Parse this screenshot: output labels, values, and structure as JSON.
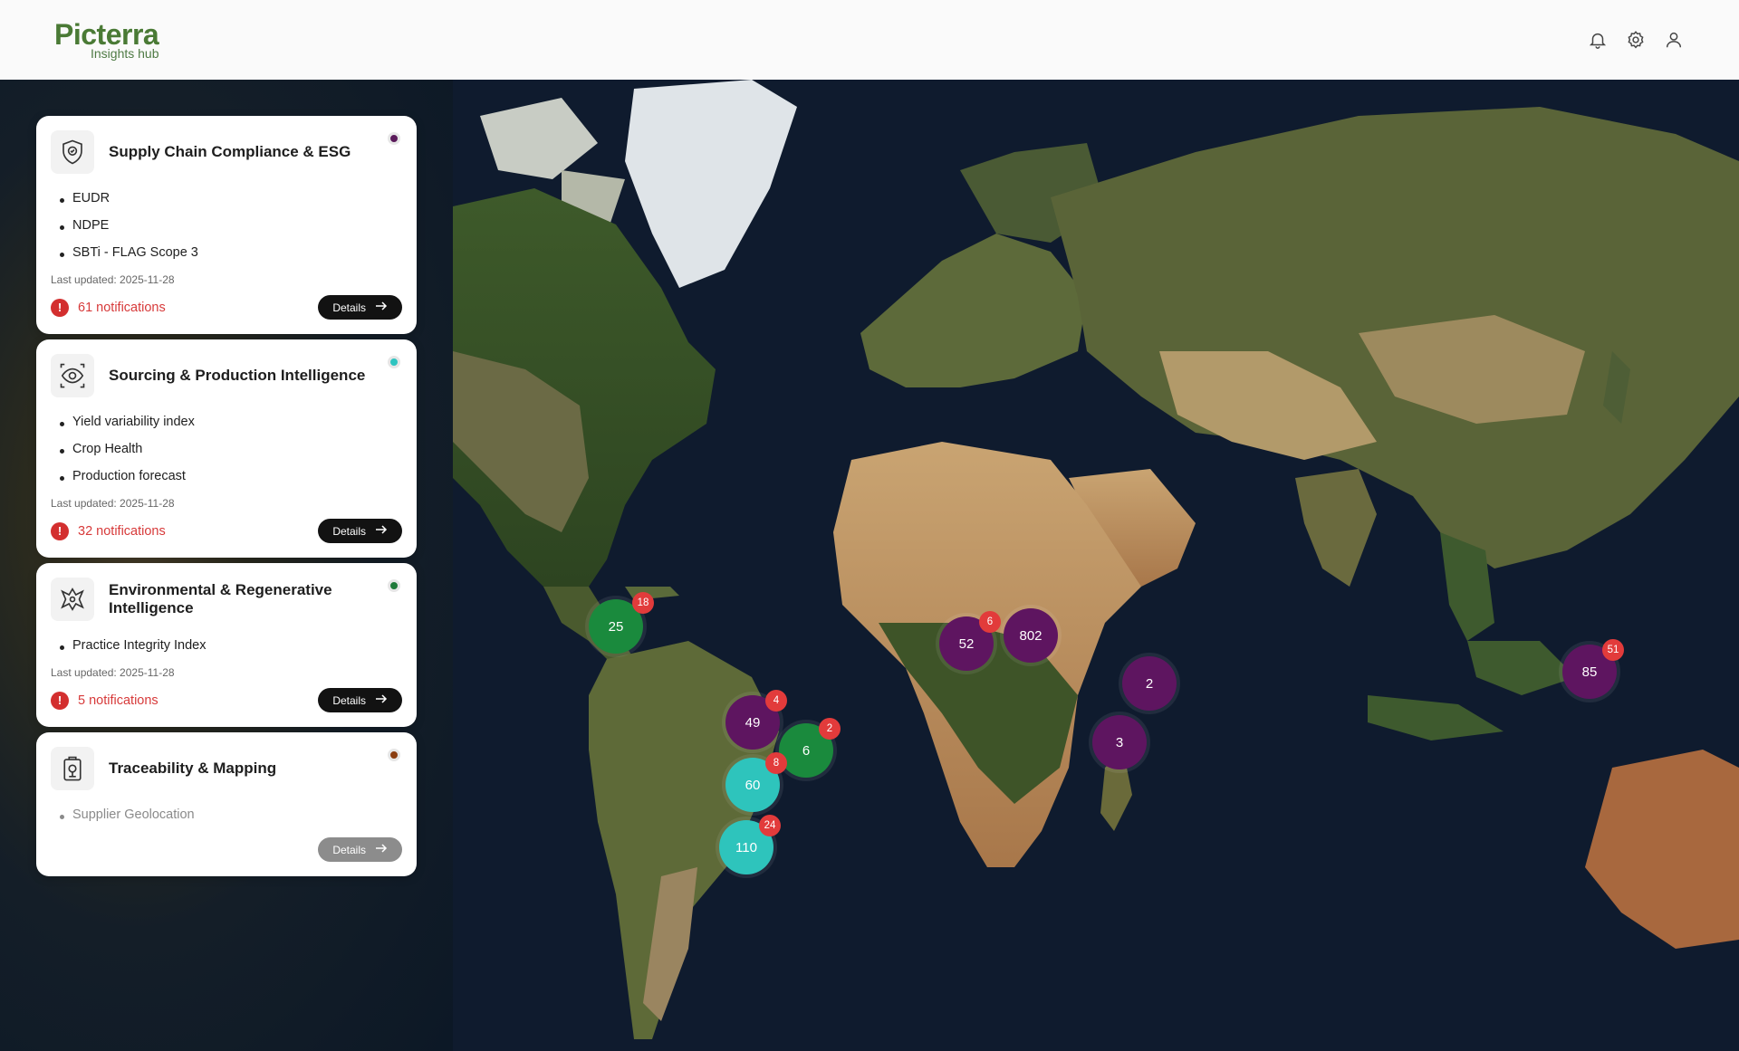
{
  "header": {
    "logo_main": "Picterra",
    "logo_sub": "Insights hub",
    "icons": [
      "bell-icon",
      "gear-icon",
      "user-icon"
    ]
  },
  "cards": [
    {
      "title": "Supply Chain Compliance & ESG",
      "dot_color": "#5a1a5a",
      "items": [
        "EUDR",
        "NDPE",
        "SBTi - FLAG Scope 3"
      ],
      "updated": "Last updated: 2025-11-28",
      "notifications": "61 notifications",
      "details": "Details"
    },
    {
      "title": "Sourcing & Production Intelligence",
      "dot_color": "#2ec4c0",
      "items": [
        "Yield variability index",
        "Crop Health",
        "Production forecast"
      ],
      "updated": "Last updated: 2025-11-28",
      "notifications": "32 notifications",
      "details": "Details"
    },
    {
      "title": "Environmental & Regenerative Intelligence",
      "dot_color": "#1f7a3a",
      "items": [
        "Practice Integrity Index"
      ],
      "updated": "Last updated: 2025-11-28",
      "notifications": "5 notifications",
      "details": "Details"
    },
    {
      "title": "Traceability & Mapping",
      "dot_color": "#8a3d10",
      "items": [
        "Supplier Geolocation"
      ],
      "details": "Details"
    }
  ],
  "colors": {
    "purple": "#5e1560",
    "green": "#1a8a3d",
    "teal": "#2ec4bc",
    "badge": "#e23b3b"
  },
  "markers": [
    {
      "value": "25",
      "badge": "18",
      "color": "green"
    },
    {
      "value": "52",
      "badge": "6",
      "color": "purple"
    },
    {
      "value": "802",
      "badge": "",
      "color": "purple"
    },
    {
      "value": "2",
      "badge": "",
      "color": "purple"
    },
    {
      "value": "3",
      "badge": "",
      "color": "purple"
    },
    {
      "value": "85",
      "badge": "51",
      "color": "purple"
    },
    {
      "value": "49",
      "badge": "4",
      "color": "purple"
    },
    {
      "value": "6",
      "badge": "2",
      "color": "green"
    },
    {
      "value": "60",
      "badge": "8",
      "color": "teal"
    },
    {
      "value": "110",
      "badge": "24",
      "color": "teal"
    }
  ]
}
